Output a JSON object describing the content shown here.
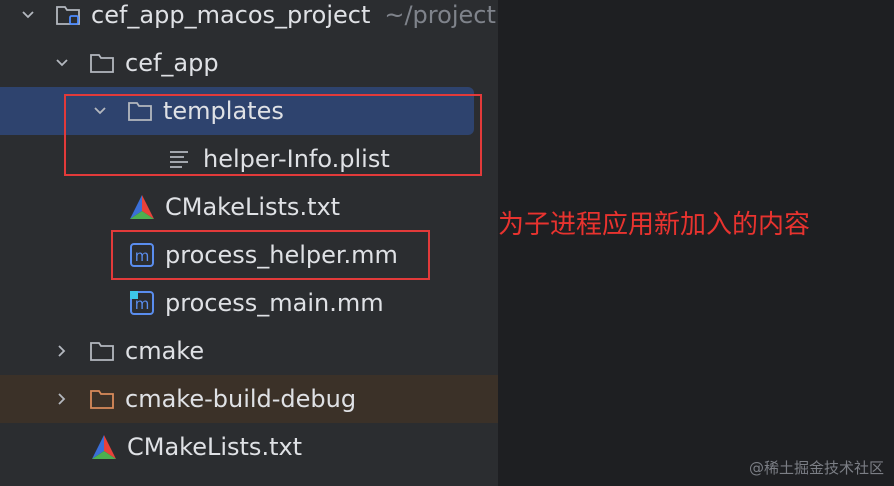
{
  "project": {
    "root_label": "cef_app_macos_project",
    "root_path": "~/project",
    "items": [
      {
        "label": "cef_app"
      },
      {
        "label": "templates"
      },
      {
        "label": "helper-Info.plist"
      },
      {
        "label": "CMakeLists.txt"
      },
      {
        "label": "process_helper.mm"
      },
      {
        "label": "process_main.mm"
      },
      {
        "label": "cmake"
      },
      {
        "label": "cmake-build-debug"
      },
      {
        "label": "CMakeLists.txt"
      }
    ]
  },
  "annotation": {
    "text": "为子进程应用新加入的内容"
  },
  "watermark": {
    "text": "@稀土掘金技术社区"
  },
  "colors": {
    "selection": "#2e436e",
    "excluded_bg": "#3b3128",
    "highlight_box": "#e23a3a",
    "annotation": "#e8332f"
  }
}
